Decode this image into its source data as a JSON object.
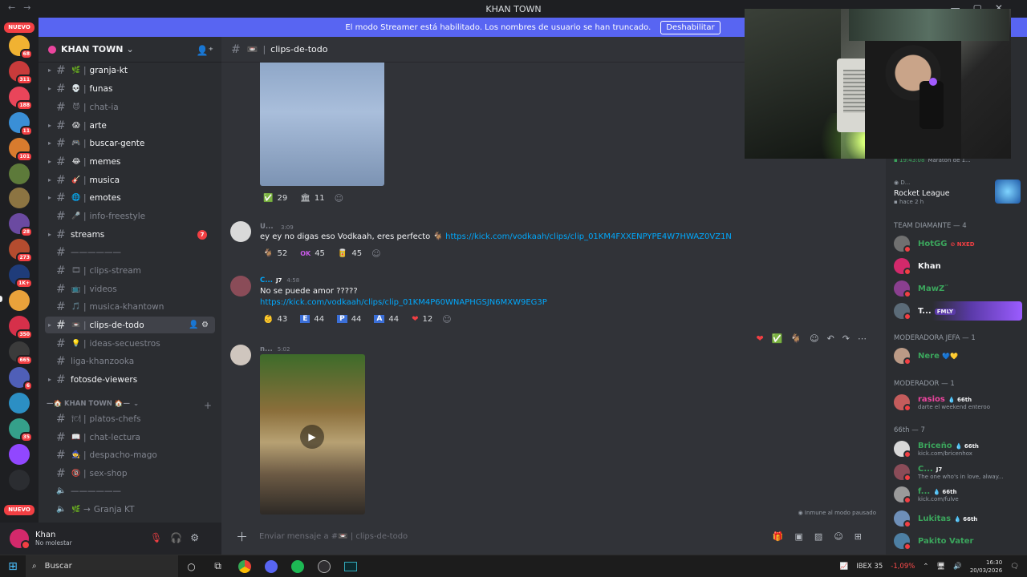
{
  "window": {
    "title": "KHAN TOWN"
  },
  "banner": {
    "text": "El modo Streamer está habilitado. Los nombres de usuario se han truncado.",
    "button": "Deshabilitar"
  },
  "guilds": {
    "nuevo_top": "NUEVO",
    "nuevo_bottom": "NUEVO",
    "badges": [
      "68",
      "311",
      "188",
      "11",
      "101",
      "28",
      "273",
      "1K+",
      "350",
      "665",
      "6",
      "35"
    ]
  },
  "server": {
    "name": "KHAN TOWN"
  },
  "channels": [
    {
      "name": "granja-kt",
      "emoji": "🌿"
    },
    {
      "name": "funas",
      "emoji": "💀"
    },
    {
      "name": "chat-ia",
      "emoji": "😈"
    },
    {
      "name": "arte",
      "emoji": "😱"
    },
    {
      "name": "buscar-gente",
      "emoji": "🎮"
    },
    {
      "name": "memes",
      "emoji": "😂"
    },
    {
      "name": "musica",
      "emoji": "🎸"
    },
    {
      "name": "emotes",
      "emoji": "🌐"
    },
    {
      "name": "info-freestyle",
      "emoji": "🎤"
    },
    {
      "name": "streams",
      "badge": "7"
    },
    {
      "name": "——————"
    },
    {
      "name": "clips-stream",
      "emoji": "🎞"
    },
    {
      "name": "videos",
      "emoji": "📺"
    },
    {
      "name": "musica-khantown",
      "emoji": "🎵"
    },
    {
      "name": "clips-de-todo",
      "emoji": "📼"
    },
    {
      "name": "ideas-secuestros",
      "emoji": "💡"
    },
    {
      "name": "liga-khanzooka"
    },
    {
      "name": "fotosde-viewers"
    },
    {
      "name": "platos-chefs",
      "emoji": "🍽"
    },
    {
      "name": "chat-lectura",
      "emoji": "📖"
    },
    {
      "name": "despacho-mago",
      "emoji": "🧙"
    },
    {
      "name": "sex-shop",
      "emoji": "🔞"
    },
    {
      "name": "——————"
    },
    {
      "name": "Granja KT",
      "emoji": "🌿",
      "prefix": "→"
    }
  ],
  "category": {
    "name": "—🏠 KHAN TOWN 🏠—"
  },
  "user": {
    "name": "Khan",
    "status": "No molestar"
  },
  "chat": {
    "channel": "clips-de-todo",
    "msg0": {
      "reactions": [
        {
          "emoji": "✅",
          "count": "29"
        },
        {
          "emoji": "🏛",
          "count": "11"
        }
      ]
    },
    "msg1": {
      "author": "U...",
      "time": "3:09",
      "text": "ey ey no digas eso Vodkaah, eres perfecto 🐐",
      "link": "https://kick.com/vodkaah/clips/clip_01KM4FXXENPYPE4W7HWAZ0VZ1N",
      "reactions": [
        {
          "emoji": "🐐",
          "count": "52"
        },
        {
          "emoji": "OK",
          "count": "45"
        },
        {
          "emoji": "🥫",
          "count": "45"
        }
      ]
    },
    "msg2": {
      "author": "C...",
      "tag": "J7",
      "time": "4:58",
      "text": "No se puede amor ?????",
      "link": "https://kick.com/vodkaah/clips/clip_01KM4P60WNAPHGSJN6MXW9EG3P",
      "reactions": [
        {
          "emoji": "👶",
          "count": "43"
        },
        {
          "emoji": "E",
          "count": "44"
        },
        {
          "emoji": "P",
          "count": "44"
        },
        {
          "emoji": "A",
          "count": "44"
        },
        {
          "emoji": "❤",
          "count": "12"
        }
      ]
    },
    "msg3": {
      "author": "n...",
      "time": "5:02"
    },
    "paused": "Inmune al modo pausado",
    "input_placeholder": "Enviar mensaje a #📼 | clips-de-todo"
  },
  "members": {
    "activity": {
      "time": "19:43:08",
      "text": "Maratón de 1...",
      "game": "Rocket League",
      "ago": "hace 2 h",
      "name": "D..."
    },
    "groups": [
      {
        "title": "TEAM DIAMANTE — 4"
      },
      {
        "title": "MODERADORA JEFA — 1"
      },
      {
        "title": "MODERADOR — 1"
      },
      {
        "title": "66th — 7"
      }
    ],
    "people": [
      {
        "name": "HotGG",
        "tag": "NXED",
        "color": "#3ba55c"
      },
      {
        "name": "Khan",
        "color": "#f2f3f5"
      },
      {
        "name": "MawZ¨",
        "color": "#3ba55c"
      },
      {
        "name": "T...",
        "tag": "FMLY",
        "color": "#f2f3f5"
      },
      {
        "name": "Nere",
        "sub": "💙💛",
        "color": "#3ba55c"
      },
      {
        "name": "rasios",
        "tag": "66th",
        "sub": "darte el weekend enteroo",
        "color": "#eb459e"
      },
      {
        "name": "Briceño",
        "tag": "66th",
        "sub": "kick.com/bricenhox",
        "color": "#3ba55c"
      },
      {
        "name": "C...",
        "tag": "J7",
        "sub": "The one who's in love, alway...",
        "color": "#3ba55c"
      },
      {
        "name": "f...",
        "tag": "66th",
        "sub": "kick.com/fulve",
        "color": "#3ba55c"
      },
      {
        "name": "Lukitas",
        "tag": "66th",
        "color": "#3ba55c"
      },
      {
        "name": "Pakito Vater",
        "color": "#3ba55c"
      }
    ]
  },
  "taskbar": {
    "search": "Buscar",
    "ticker": "IBEX 35",
    "change": "-1,09%",
    "time": "16:30",
    "date": "20/03/2026"
  }
}
